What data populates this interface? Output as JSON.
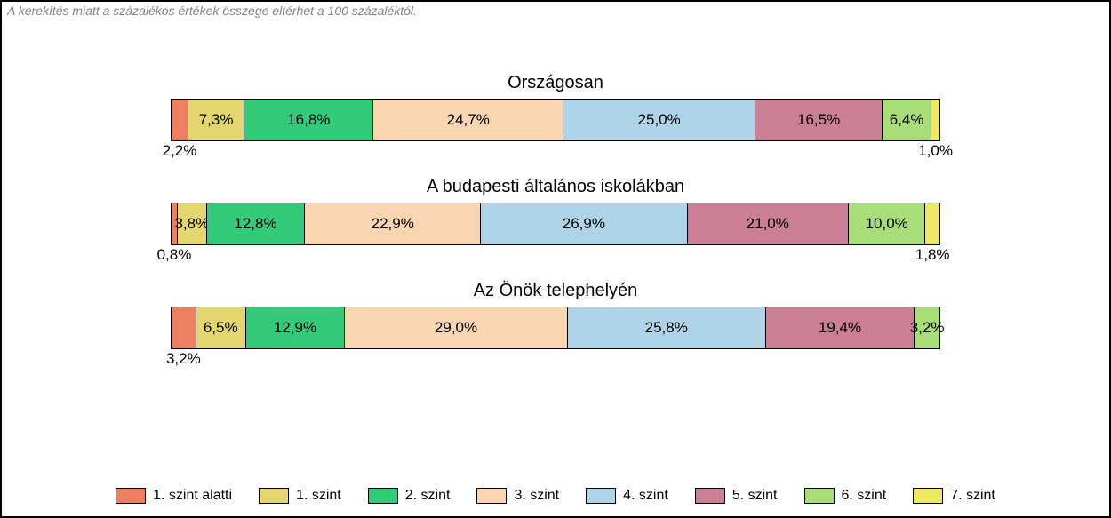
{
  "note": "A kerekítés miatt a százalékos értékek összege eltérhet a 100 százaléktól.",
  "colors": {
    "c0": "#ee8062",
    "c1": "#e3d66f",
    "c2": "#32cb7a",
    "c3": "#f9d5b0",
    "c4": "#b0d4e7",
    "c5": "#cb7f95",
    "c6": "#a9dd78",
    "c7": "#eee764"
  },
  "legend": [
    {
      "key": "c0",
      "label": "1. szint alatti"
    },
    {
      "key": "c1",
      "label": "1. szint"
    },
    {
      "key": "c2",
      "label": "2. szint"
    },
    {
      "key": "c3",
      "label": "3. szint"
    },
    {
      "key": "c4",
      "label": "4. szint"
    },
    {
      "key": "c5",
      "label": "5. szint"
    },
    {
      "key": "c6",
      "label": "6. szint"
    },
    {
      "key": "c7",
      "label": "7. szint"
    }
  ],
  "chart_data": {
    "type": "bar",
    "stacked": true,
    "orientation": "horizontal",
    "categories": [
      "Országosan",
      "A budapesti általános iskolákban",
      "Az Önök telephelyén"
    ],
    "series_keys": [
      "c0",
      "c1",
      "c2",
      "c3",
      "c4",
      "c5",
      "c6",
      "c7"
    ],
    "rows": [
      {
        "title": "Országosan",
        "values": [
          2.2,
          7.3,
          16.8,
          24.7,
          25.0,
          16.5,
          6.4,
          1.0
        ],
        "labels": [
          "2,2%",
          "7,3%",
          "16,8%",
          "24,7%",
          "25,0%",
          "16,5%",
          "6,4%",
          "1,0%"
        ],
        "below": [
          true,
          false,
          false,
          false,
          false,
          false,
          false,
          true
        ]
      },
      {
        "title": "A budapesti általános iskolákban",
        "values": [
          0.8,
          3.8,
          12.8,
          22.9,
          26.9,
          21.0,
          10.0,
          1.8
        ],
        "labels": [
          "0,8%",
          "3,8%",
          "12,8%",
          "22,9%",
          "26,9%",
          "21,0%",
          "10,0%",
          "1,8%"
        ],
        "below": [
          true,
          false,
          false,
          false,
          false,
          false,
          false,
          true
        ]
      },
      {
        "title": "Az Önök telephelyén",
        "values": [
          3.2,
          6.5,
          12.9,
          29.0,
          25.8,
          19.4,
          3.2,
          0.0
        ],
        "labels": [
          "3,2%",
          "6,5%",
          "12,9%",
          "29,0%",
          "25,8%",
          "19,4%",
          "3,2%",
          ""
        ],
        "below": [
          true,
          false,
          false,
          false,
          false,
          false,
          false,
          false
        ]
      }
    ],
    "xlabel": "",
    "ylabel": "",
    "unit": "%",
    "xlim": [
      0,
      100
    ]
  }
}
